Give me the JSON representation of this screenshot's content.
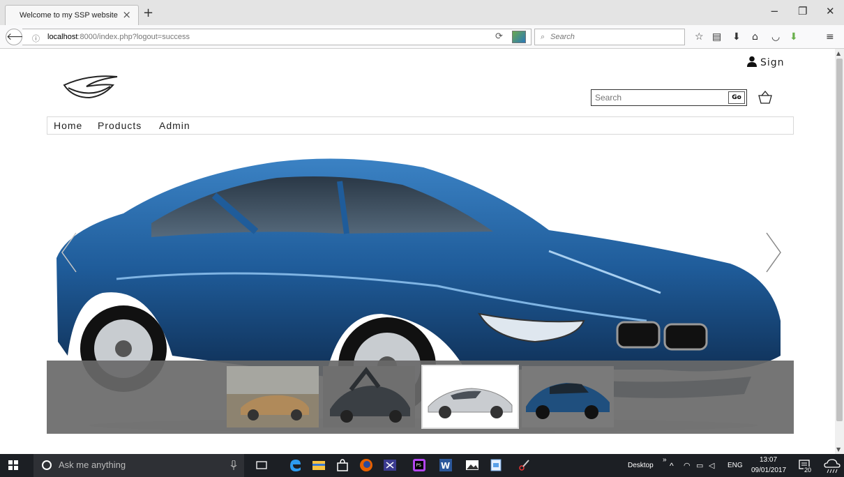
{
  "browser": {
    "tab_title": "Welcome to my SSP website",
    "tab_close": "×",
    "new_tab": "+",
    "url_host": "localhost",
    "url_rest": ":8000/index.php?logout=success",
    "search_placeholder": "Search",
    "controls": {
      "minimize": "−",
      "maximize": "❐",
      "close": "✕"
    }
  },
  "header": {
    "sign_label": "Sign",
    "search_placeholder": "Search",
    "go_label": "Go"
  },
  "nav": {
    "items": [
      {
        "label": "Home"
      },
      {
        "label": "Products"
      },
      {
        "label": "Admin"
      }
    ]
  },
  "carousel": {
    "active_index": 2,
    "thumbnail_count": 4
  },
  "taskbar": {
    "cortana_placeholder": "Ask me anything",
    "desktop_label": "Desktop",
    "language": "ENG",
    "time": "13:07",
    "date": "09/01/2017",
    "notifications": "20"
  },
  "colors": {
    "car_blue": "#1f5c9a",
    "thumb_strip": "#6b6b6b",
    "taskbar": "#1c1f24"
  }
}
